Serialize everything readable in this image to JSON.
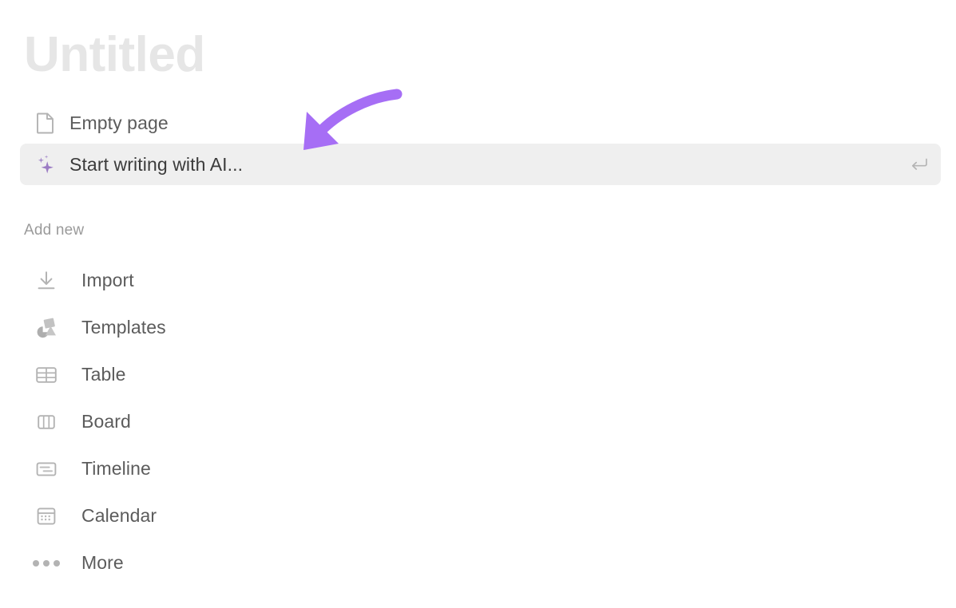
{
  "colors": {
    "title": "#e6e6e6",
    "text": "#5c5c5c",
    "text_active": "#3b3b3b",
    "muted": "#9a9a9a",
    "icon": "#b3b3b3",
    "highlight_bg": "#efefef",
    "accent_purple": "#a66ef5",
    "ai_icon_purple": "#9b7bc4",
    "background": "#ffffff"
  },
  "page_title": "Untitled",
  "primary_options": [
    {
      "label": "Empty page",
      "icon": "document-page-icon",
      "highlighted": false,
      "shortcut_icon": ""
    },
    {
      "label": "Start writing with AI...",
      "icon": "ai-sparkle-icon",
      "highlighted": true,
      "shortcut_icon": "enter-return-icon"
    }
  ],
  "section": {
    "header": "Add new",
    "items": [
      {
        "label": "Import",
        "icon": "download-arrow-icon"
      },
      {
        "label": "Templates",
        "icon": "templates-shapes-icon"
      },
      {
        "label": "Table",
        "icon": "table-grid-icon"
      },
      {
        "label": "Board",
        "icon": "board-columns-icon"
      },
      {
        "label": "Timeline",
        "icon": "timeline-bars-icon"
      },
      {
        "label": "Calendar",
        "icon": "calendar-icon"
      },
      {
        "label": "More",
        "icon": "ellipsis-more-icon"
      }
    ]
  },
  "annotation": {
    "type": "curved-arrow",
    "color": "#a66ef5",
    "points_to": "Start writing with AI..."
  }
}
